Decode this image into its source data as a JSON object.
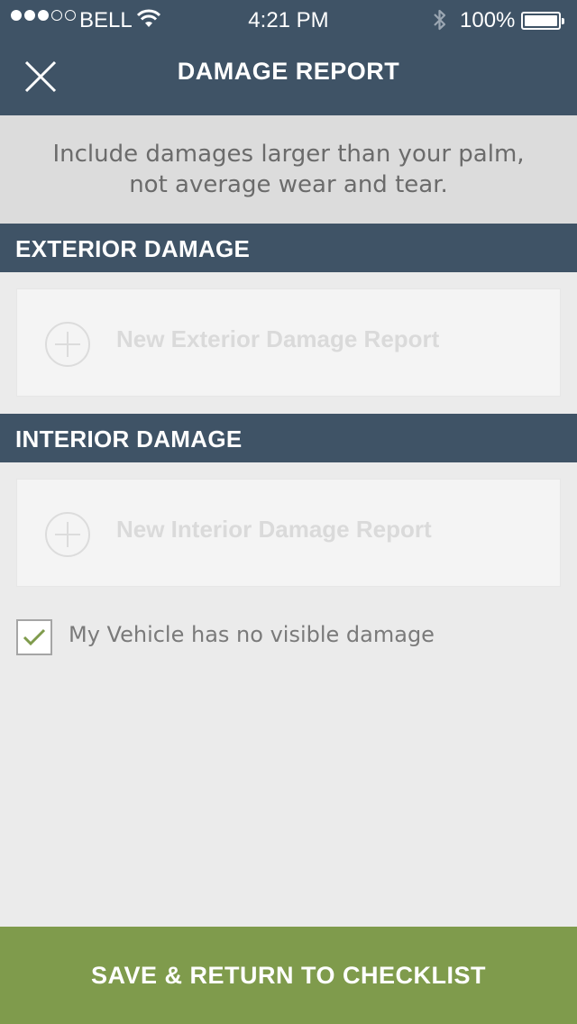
{
  "status_bar": {
    "carrier": "BELL",
    "time": "4:21 PM",
    "battery_percent": "100%",
    "signal_bars_filled": 3,
    "signal_bars_total": 5,
    "icons": [
      "signal-dots",
      "wifi-icon",
      "bluetooth-icon",
      "battery-icon"
    ]
  },
  "nav": {
    "title": "DAMAGE REPORT",
    "close_icon": "close-icon"
  },
  "info": {
    "line1": "Include damages larger than your palm,",
    "line2": "not average wear and tear."
  },
  "exterior": {
    "header": "EXTERIOR DAMAGE",
    "add_label": "New Exterior Damage Report",
    "add_icon": "plus-circle-icon"
  },
  "interior": {
    "header": "INTERIOR DAMAGE",
    "add_label": "New Interior Damage Report",
    "add_icon": "plus-circle-icon"
  },
  "no_damage": {
    "label": "My Vehicle has no visible damage",
    "checked": true
  },
  "footer": {
    "save_label": "SAVE & RETURN TO CHECKLIST"
  },
  "colors": {
    "header_bg": "#3f5366",
    "accent_green": "#7f9b4c",
    "page_bg": "#ebebeb",
    "info_bg": "#dcdcdc"
  }
}
